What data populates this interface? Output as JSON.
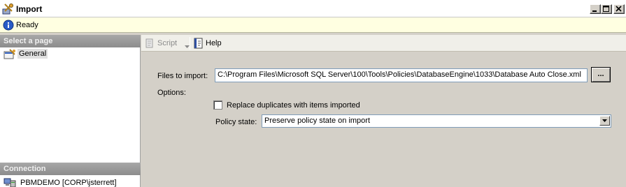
{
  "window": {
    "title": "Import",
    "controls": [
      "minimize",
      "maximize",
      "close"
    ]
  },
  "status": {
    "text": "Ready",
    "icon": "info-icon"
  },
  "left_pane": {
    "select_page_header": "Select a page",
    "pages": [
      {
        "label": "General",
        "icon": "properties-page-icon",
        "selected": true
      }
    ],
    "connection_header": "Connection",
    "connection": {
      "label": "PBMDEMO [CORP\\jsterrett]",
      "icon": "server-connection-icon"
    }
  },
  "toolbar": {
    "script_label": "Script",
    "script_enabled": false,
    "help_label": "Help"
  },
  "form": {
    "files_label": "Files to import:",
    "files_value": "C:\\Program Files\\Microsoft SQL Server\\100\\Tools\\Policies\\DatabaseEngine\\1033\\Database Auto Close.xml",
    "browse_label": "...",
    "options_label": "Options:",
    "replace_label": "Replace duplicates with items imported",
    "replace_checked": false,
    "policy_state_label": "Policy state:",
    "policy_state_value": "Preserve policy state on import"
  }
}
